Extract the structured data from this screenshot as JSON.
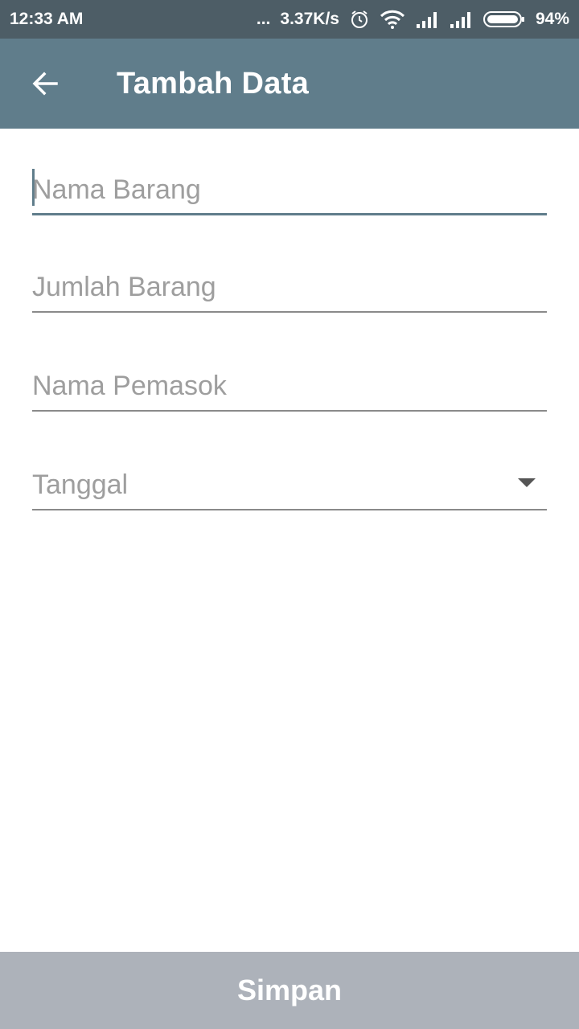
{
  "status_bar": {
    "time": "12:33 AM",
    "more": "...",
    "speed": "3.37K/s",
    "battery": "94%",
    "icons": [
      "alarm-icon",
      "wifi-icon",
      "signal-icon",
      "signal-icon",
      "battery-icon"
    ]
  },
  "app_bar": {
    "title": "Tambah Data",
    "back_icon": "arrow-back-icon"
  },
  "form": {
    "nama_barang": {
      "placeholder": "Nama Barang",
      "value": ""
    },
    "jumlah_barang": {
      "placeholder": "Jumlah Barang",
      "value": ""
    },
    "nama_pemasok": {
      "placeholder": "Nama Pemasok",
      "value": ""
    },
    "tanggal": {
      "placeholder": "Tanggal",
      "value": ""
    }
  },
  "actions": {
    "save_label": "Simpan"
  },
  "colors": {
    "primary": "#607d8b",
    "status_bar": "#4d5d66",
    "button": "#adb2ba"
  }
}
